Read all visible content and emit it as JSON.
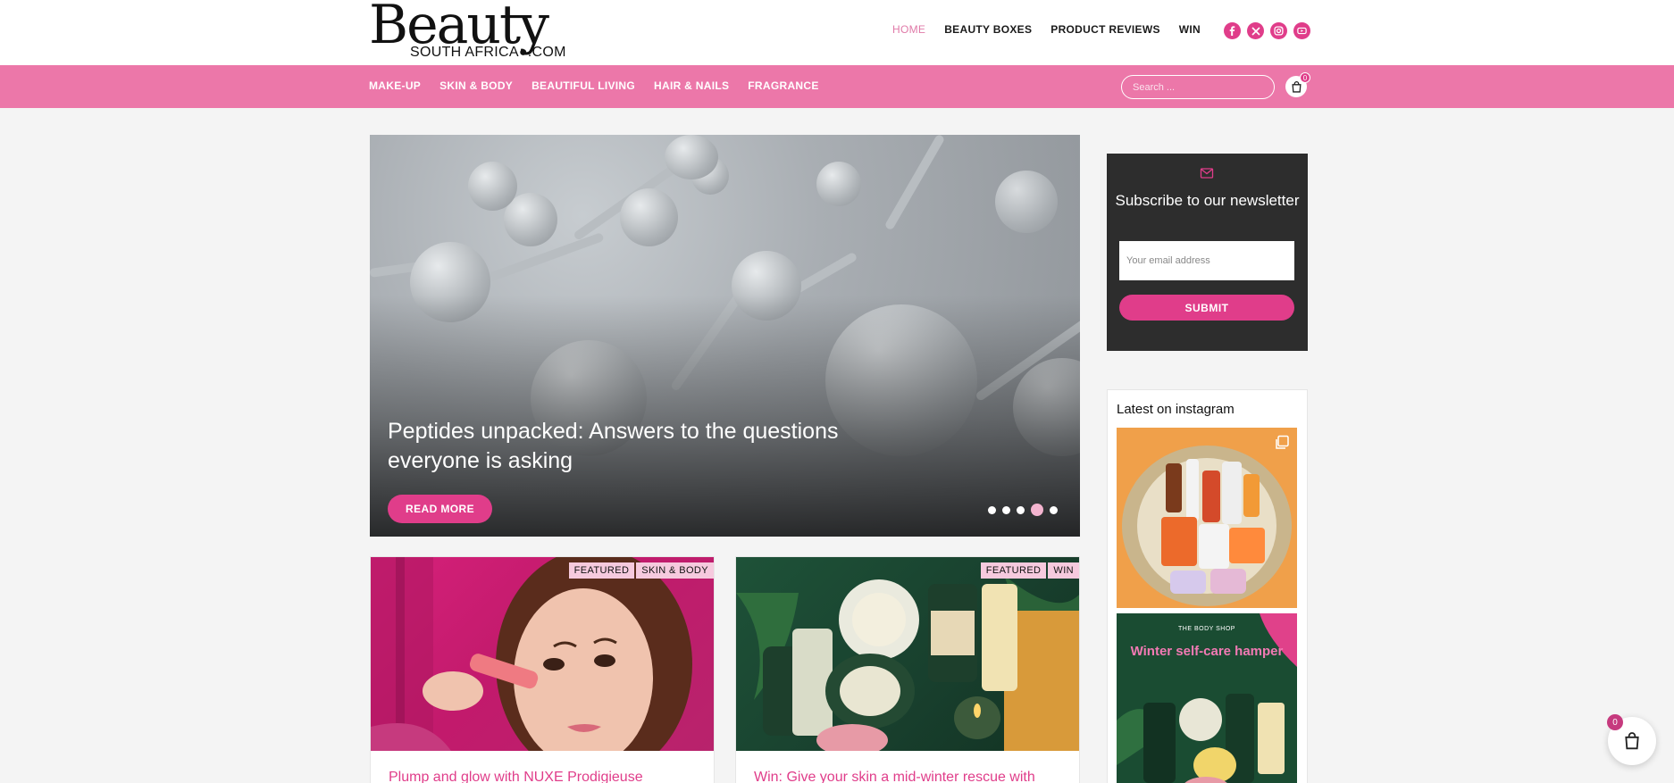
{
  "logo": {
    "main": "Beauty",
    "sub": "SOUTH AFRICA●.COM"
  },
  "topnav": [
    {
      "label": "HOME",
      "active": true
    },
    {
      "label": "BEAUTY BOXES"
    },
    {
      "label": "PRODUCT REVIEWS"
    },
    {
      "label": "WIN"
    }
  ],
  "socials": [
    "facebook-icon",
    "x-twitter-icon",
    "instagram-icon",
    "youtube-icon"
  ],
  "catnav": [
    "MAKE-UP",
    "SKIN & BODY",
    "BEAUTIFUL LIVING",
    "HAIR & NAILS",
    "FRAGRANCE"
  ],
  "search": {
    "placeholder": "Search ..."
  },
  "cart": {
    "count": "0"
  },
  "hero": {
    "title": "Peptides unpacked: Answers to the questions everyone is asking",
    "cta": "READ MORE",
    "slides": 5,
    "active_slide": 4
  },
  "cards": [
    {
      "tags": [
        "FEATURED",
        "SKIN & BODY"
      ],
      "title": "Plump and glow with NUXE Prodigieuse"
    },
    {
      "tags": [
        "FEATURED",
        "WIN"
      ],
      "title": "Win: Give your skin a mid-winter rescue with"
    }
  ],
  "newsletter": {
    "title": "Subscribe to our newsletter",
    "placeholder": "Your email address",
    "submit": "SUBMIT"
  },
  "instagram": {
    "title": "Latest on instagram",
    "post2_brand": "THE BODY SHOP",
    "post2_headline": "Winter self-care hamper"
  },
  "colors": {
    "brand_pink": "#ec77a9",
    "accent": "#e03d8a",
    "dark": "#2d2d2d"
  }
}
